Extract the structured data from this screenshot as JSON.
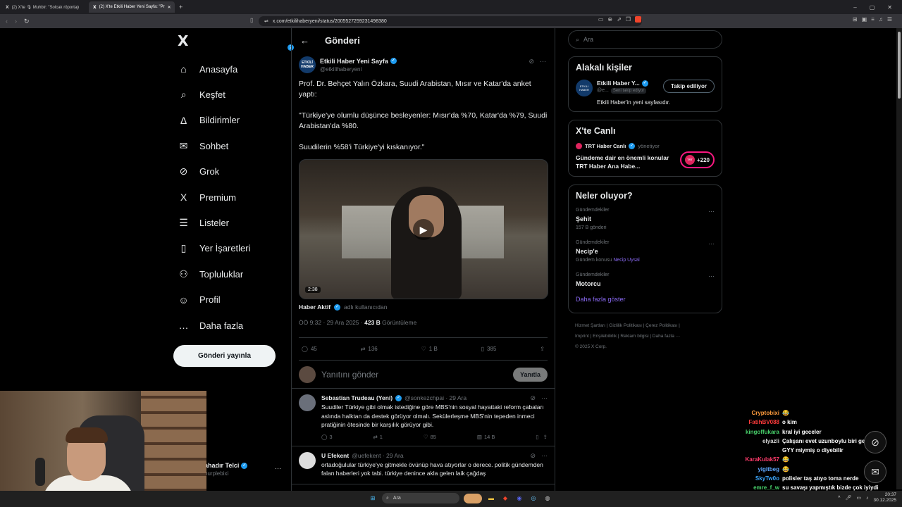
{
  "browser": {
    "tabs": [
      {
        "label": "(2) X'te 🎙 Muhbir: \"Solcak röportajı",
        "active": false
      },
      {
        "label": "(2) X'te Etkili Haber Yeni Sayfa: \"Pr",
        "active": true
      }
    ],
    "new_tab": "+",
    "url": "x.com/etkilihaberyeni/status/2005527259231498380"
  },
  "nav": {
    "logo": "X",
    "items": [
      {
        "label": "Anasayfa",
        "icon": "home-icon",
        "glyph": "⌂"
      },
      {
        "label": "Keşfet",
        "icon": "search-icon",
        "glyph": "⌕"
      },
      {
        "label": "Bildirimler",
        "icon": "bell-icon",
        "glyph": "Δ",
        "badge": "2"
      },
      {
        "label": "Sohbet",
        "icon": "mail-icon",
        "glyph": "✉"
      },
      {
        "label": "Grok",
        "icon": "grok-icon",
        "glyph": "⊘"
      },
      {
        "label": "Premium",
        "icon": "x-premium-icon",
        "glyph": "X"
      },
      {
        "label": "Listeler",
        "icon": "list-icon",
        "glyph": "☰"
      },
      {
        "label": "Yer İşaretleri",
        "icon": "bookmark-icon",
        "glyph": "▯"
      },
      {
        "label": "Topluluklar",
        "icon": "communities-icon",
        "glyph": "⚇"
      },
      {
        "label": "Profil",
        "icon": "profile-icon",
        "glyph": "☺"
      },
      {
        "label": "Daha fazla",
        "icon": "more-icon",
        "glyph": "…"
      }
    ],
    "post_button": "Gönderi yayınla",
    "profile_name": "ahadır Telci",
    "profile_handle": "purplebixi"
  },
  "post": {
    "header_title": "Gönderi",
    "author_name": "Etkili Haber Yeni Sayfa",
    "author_handle": "@etkilihaberyeni",
    "avatar_text": "ETKİLİ HABER",
    "paragraphs": [
      "Prof. Dr. Behçet Yalın Özkara, Suudi Arabistan, Mısır ve Katar'da anket yaptı:",
      "\"Türkiye'ye olumlu düşünce besleyenler: Mısır'da %70, Katar'da %79, Suudi Arabistan'da %80.",
      "Suudilerin %58'i Türkiye'yi kıskanıyor.\""
    ],
    "video_duration": "2:38",
    "credit_name": "Haber Aktif",
    "credit_suffix": "adlı kullanıcıdan",
    "time": "ÖÖ 9:32 · 29 Ara 2025 ·",
    "views": "423 B",
    "views_label": "Görüntüleme",
    "replies": "45",
    "reposts": "136",
    "likes": "1 B",
    "bookmarks": "385",
    "reply_placeholder": "Yanıtını gönder",
    "reply_button": "Yanıtla"
  },
  "replies": [
    {
      "name": "Sebastian Trudeau (Yeni)",
      "handle": "@sonkezchpai · 29 Ara",
      "text": "Suudiler Türkiye gibi olmak istediğine göre MBS'nin sosyal hayattaki reform çabaları aslında halktan da destek görüyor olmalı. Sekülerleşme MBS'nin tepeden inmeci pratiğinin ötesinde bir karşılık görüyor gibi.",
      "replies": "3",
      "reposts": "1",
      "likes": "85",
      "views": "14 B"
    },
    {
      "name": "U Efekent",
      "handle": "@uefekent · 29 Ara",
      "text": "ortadoğulular türkiye'ye gitmekle övünüp hava atıyorlar o derece. politik gündemden falan haberleri yok tabi. türkiye denince akla gelen laik çağdaş"
    }
  ],
  "sidebar": {
    "search_placeholder": "Ara",
    "relevant_title": "Alakalı kişiler",
    "person_name": "Etkili Haber Y...",
    "person_handle": "@e...",
    "person_badge": "Seni takip ediyor",
    "person_avatar": "ETKİLİ HABER",
    "follow_button": "Takip ediliyor",
    "person_bio": "Etkili Haber'in yeni sayfasıdır.",
    "live_title": "X'te Canlı",
    "live_host": "TRT Haber Canlı",
    "live_role": "yönetiyor",
    "live_text": "Gündeme dair en önemli konular TRT Haber Ana Habe...",
    "live_count": "+220",
    "live_logo": "TRT",
    "trends_title": "Neler oluyor?",
    "trends": [
      {
        "category": "Gündemdekiler",
        "name": "Şehit",
        "sub": "157 B gönderi",
        "link": ""
      },
      {
        "category": "Gündemdekiler",
        "name": "Necip'e",
        "sub": "Gündem konusu",
        "link": "Necip Uysal"
      },
      {
        "category": "Gündemdekiler",
        "name": "Motorcu",
        "sub": "",
        "link": ""
      }
    ],
    "show_more": "Daha fazla göster",
    "footer_lines": [
      "Hizmet Şartları  |  Gizlilik Politikası  |  Çerez Politikası  |",
      "Imprint  |  Erişilebilirlik  |  Reklam bilgisi  |  Daha fazla ···",
      "© 2025 X Corp."
    ]
  },
  "chat": [
    {
      "user": "Cryptobixi",
      "color": "#ff9b3d",
      "msg": "😂"
    },
    {
      "user": "FatihBV088",
      "color": "#ff3b3b",
      "msg": "o kim"
    },
    {
      "user": "kingoffukara",
      "color": "#48d16b",
      "msg": "kral iyi geceler"
    },
    {
      "user": "elyazli",
      "color": "#d8d8d8",
      "msg": "Çalışanı evet uzunboylu biri geliyordu, GYY miymiş o diyebilir"
    },
    {
      "user": "KaraKulak57",
      "color": "#ff3b6b",
      "msg": "😂"
    },
    {
      "user": "yigitbeg",
      "color": "#5fa8ff",
      "msg": "😂"
    },
    {
      "user": "SkyTw0o",
      "color": "#3ba7ff",
      "msg": "polisler taş atıyo toma nerde"
    },
    {
      "user": "emre_f_w",
      "color": "#48d16b",
      "msg": "su savaşı yapmıştık bizde çok iyiydi"
    },
    {
      "user": "Stapuu",
      "color": "#8fb8ff",
      "msg": "😂"
    }
  ],
  "taskbar": {
    "search": "Ara",
    "time": "20:37",
    "date": "30.12.2025"
  }
}
